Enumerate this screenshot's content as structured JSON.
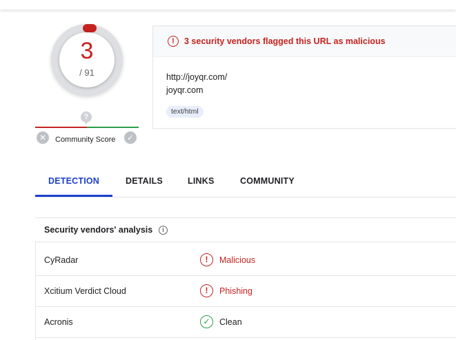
{
  "score": {
    "detections": "3",
    "total": "/ 91",
    "color": "#c5221f"
  },
  "community": {
    "label": "Community Score",
    "unknown_symbol": "?"
  },
  "alert": {
    "message": "3 security vendors flagged this URL as malicious",
    "icon": "exclamation-circle-icon"
  },
  "resource": {
    "url": "http://joyqr.com/",
    "domain": "joyqr.com",
    "tag": "text/html"
  },
  "tabs": [
    {
      "label": "DETECTION",
      "active": true
    },
    {
      "label": "DETAILS",
      "active": false
    },
    {
      "label": "LINKS",
      "active": false
    },
    {
      "label": "COMMUNITY",
      "active": false
    }
  ],
  "analysis": {
    "title": "Security vendors' analysis",
    "rows": [
      {
        "vendor": "CyRadar",
        "verdict": "Malicious",
        "status": "bad"
      },
      {
        "vendor": "Xcitium Verdict Cloud",
        "verdict": "Phishing",
        "status": "bad"
      },
      {
        "vendor": "Acronis",
        "verdict": "Clean",
        "status": "good"
      }
    ]
  },
  "colors": {
    "malicious": "#c5221f",
    "clean": "#2e9b4a",
    "accent": "#1a3fca"
  }
}
